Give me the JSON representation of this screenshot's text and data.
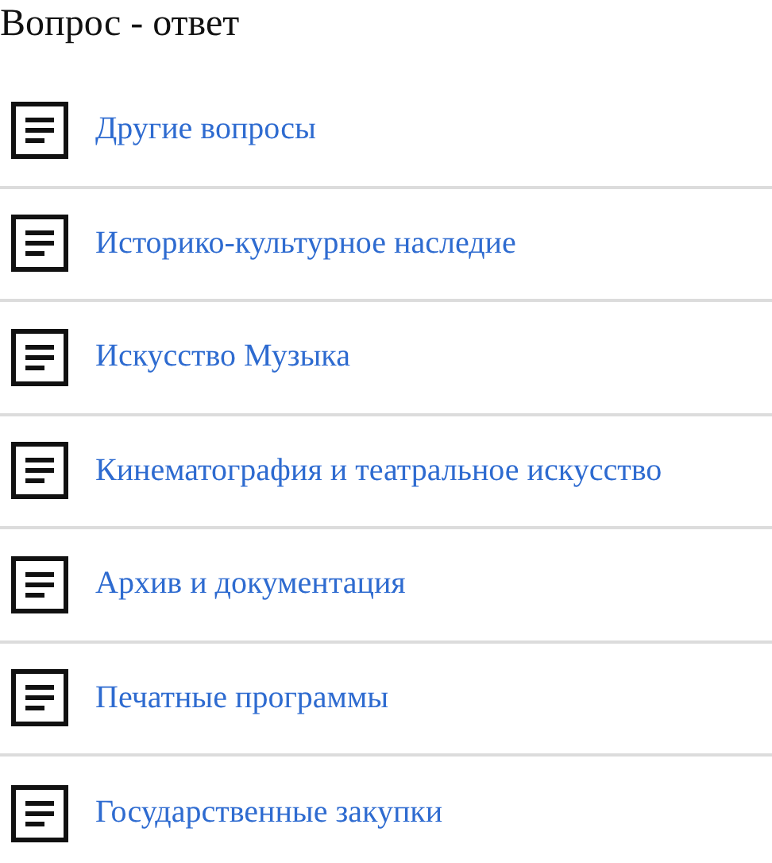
{
  "title": "Вопрос - ответ",
  "items": [
    {
      "label": "Другие вопросы"
    },
    {
      "label": "Историко-культурное наследие"
    },
    {
      "label": "Искусство Музыка"
    },
    {
      "label": "Кинематография и театральное искусство"
    },
    {
      "label": "Архив и документация"
    },
    {
      "label": "Печатные программы"
    },
    {
      "label": "Государственные закупки"
    }
  ]
}
